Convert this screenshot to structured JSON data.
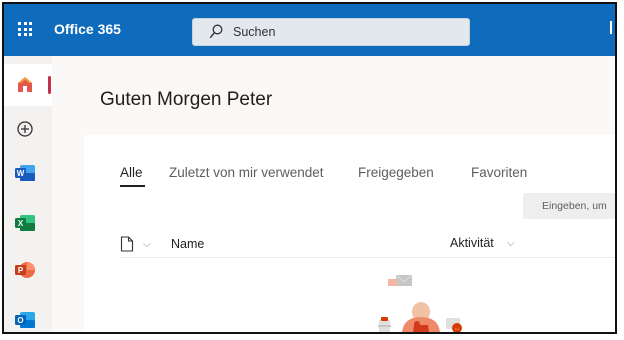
{
  "topbar": {
    "app_name": "Office 365",
    "search_placeholder": "Suchen",
    "bg_color": "#0f6cbd"
  },
  "rail": {
    "items": [
      {
        "name": "home",
        "icon": "home-icon",
        "active": true
      },
      {
        "name": "create",
        "icon": "add-circle-icon"
      },
      {
        "name": "word",
        "icon": "word-icon",
        "letter": "W"
      },
      {
        "name": "excel",
        "icon": "excel-icon",
        "letter": "X"
      },
      {
        "name": "powerpoint",
        "icon": "powerpoint-icon",
        "letter": "P"
      },
      {
        "name": "outlook",
        "icon": "outlook-icon",
        "letter": "O"
      }
    ]
  },
  "main": {
    "greeting": "Guten Morgen Peter",
    "tabs": [
      {
        "label": "Alle",
        "active": true
      },
      {
        "label": "Zuletzt von mir verwendet"
      },
      {
        "label": "Freigegeben"
      },
      {
        "label": "Favoriten"
      }
    ],
    "filter_placeholder": "Eingeben, um",
    "columns": {
      "name": "Name",
      "activity": "Aktivität"
    }
  }
}
